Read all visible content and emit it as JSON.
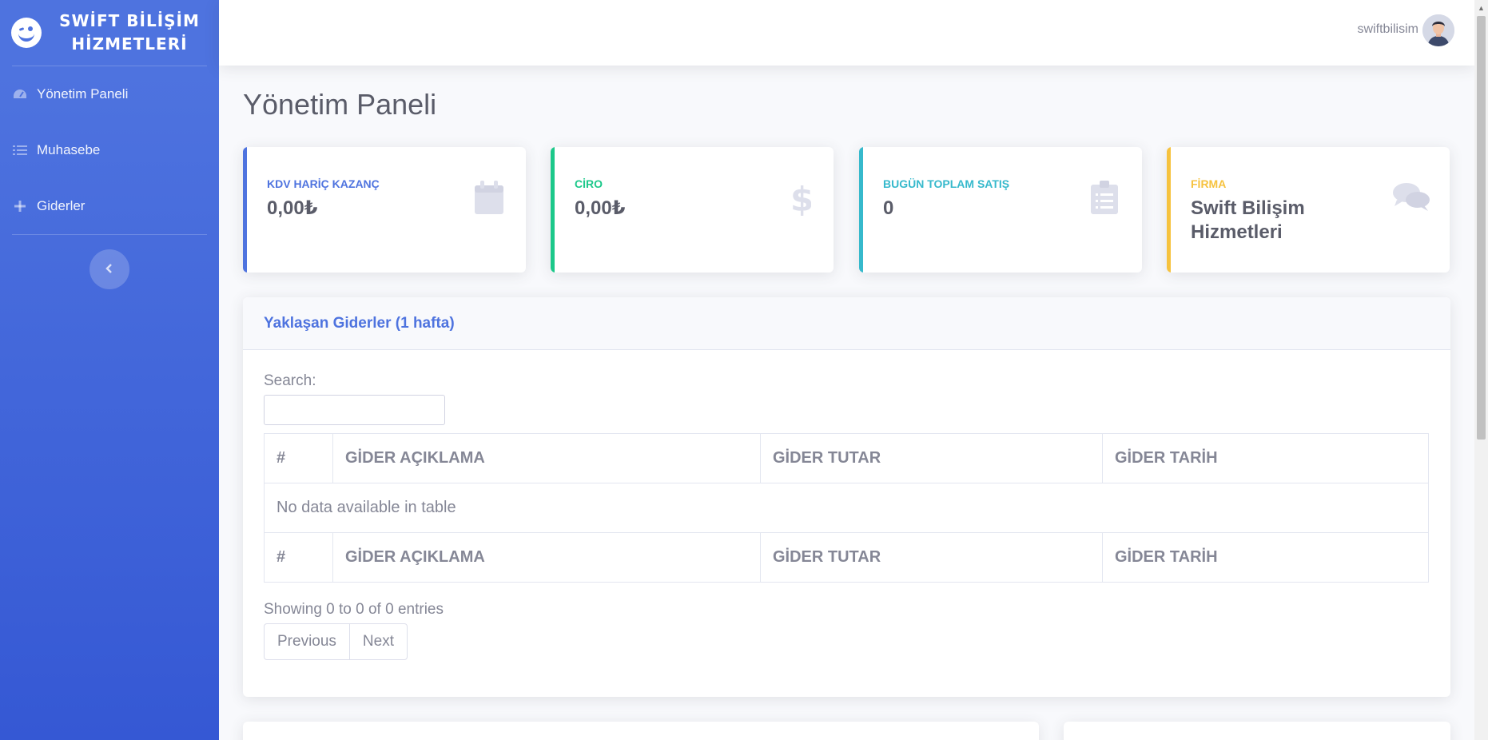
{
  "brand": {
    "line1": "SWİFT BİLİŞİM",
    "line2": "HİZMETLERİ"
  },
  "sidebar": {
    "items": [
      {
        "label": "Yönetim Paneli",
        "icon": "tachometer-icon"
      },
      {
        "label": "Muhasebe",
        "icon": "list-icon"
      },
      {
        "label": "Giderler",
        "icon": "plus-icon"
      }
    ],
    "toggle_icon": "chevron-left-icon"
  },
  "topbar": {
    "user_name": "swiftbilisim"
  },
  "page": {
    "title": "Yönetim Paneli"
  },
  "cards": [
    {
      "label": "KDV HARİÇ KAZANÇ",
      "value": "0,00₺",
      "color": "#4e73df",
      "icon": "calendar-icon"
    },
    {
      "label": "CİRO",
      "value": "0,00₺",
      "color": "#1cc88a",
      "icon": "dollar-icon"
    },
    {
      "label": "BUGÜN TOPLAM SATIŞ",
      "value": "0",
      "color": "#36b9cc",
      "icon": "clipboard-list-icon"
    },
    {
      "label": "FİRMA",
      "value": "Swift Bilişim Hizmetleri",
      "color": "#f6c23e",
      "icon": "comments-icon"
    }
  ],
  "expenses_panel": {
    "title": "Yaklaşan Giderler (1 hafta)",
    "search_label": "Search:",
    "columns": [
      "#",
      "GİDER AÇIKLAMA",
      "GİDER TUTAR",
      "GİDER TARİH"
    ],
    "empty_message": "No data available in table",
    "info": "Showing 0 to 0 of 0 entries",
    "previous": "Previous",
    "next": "Next"
  }
}
